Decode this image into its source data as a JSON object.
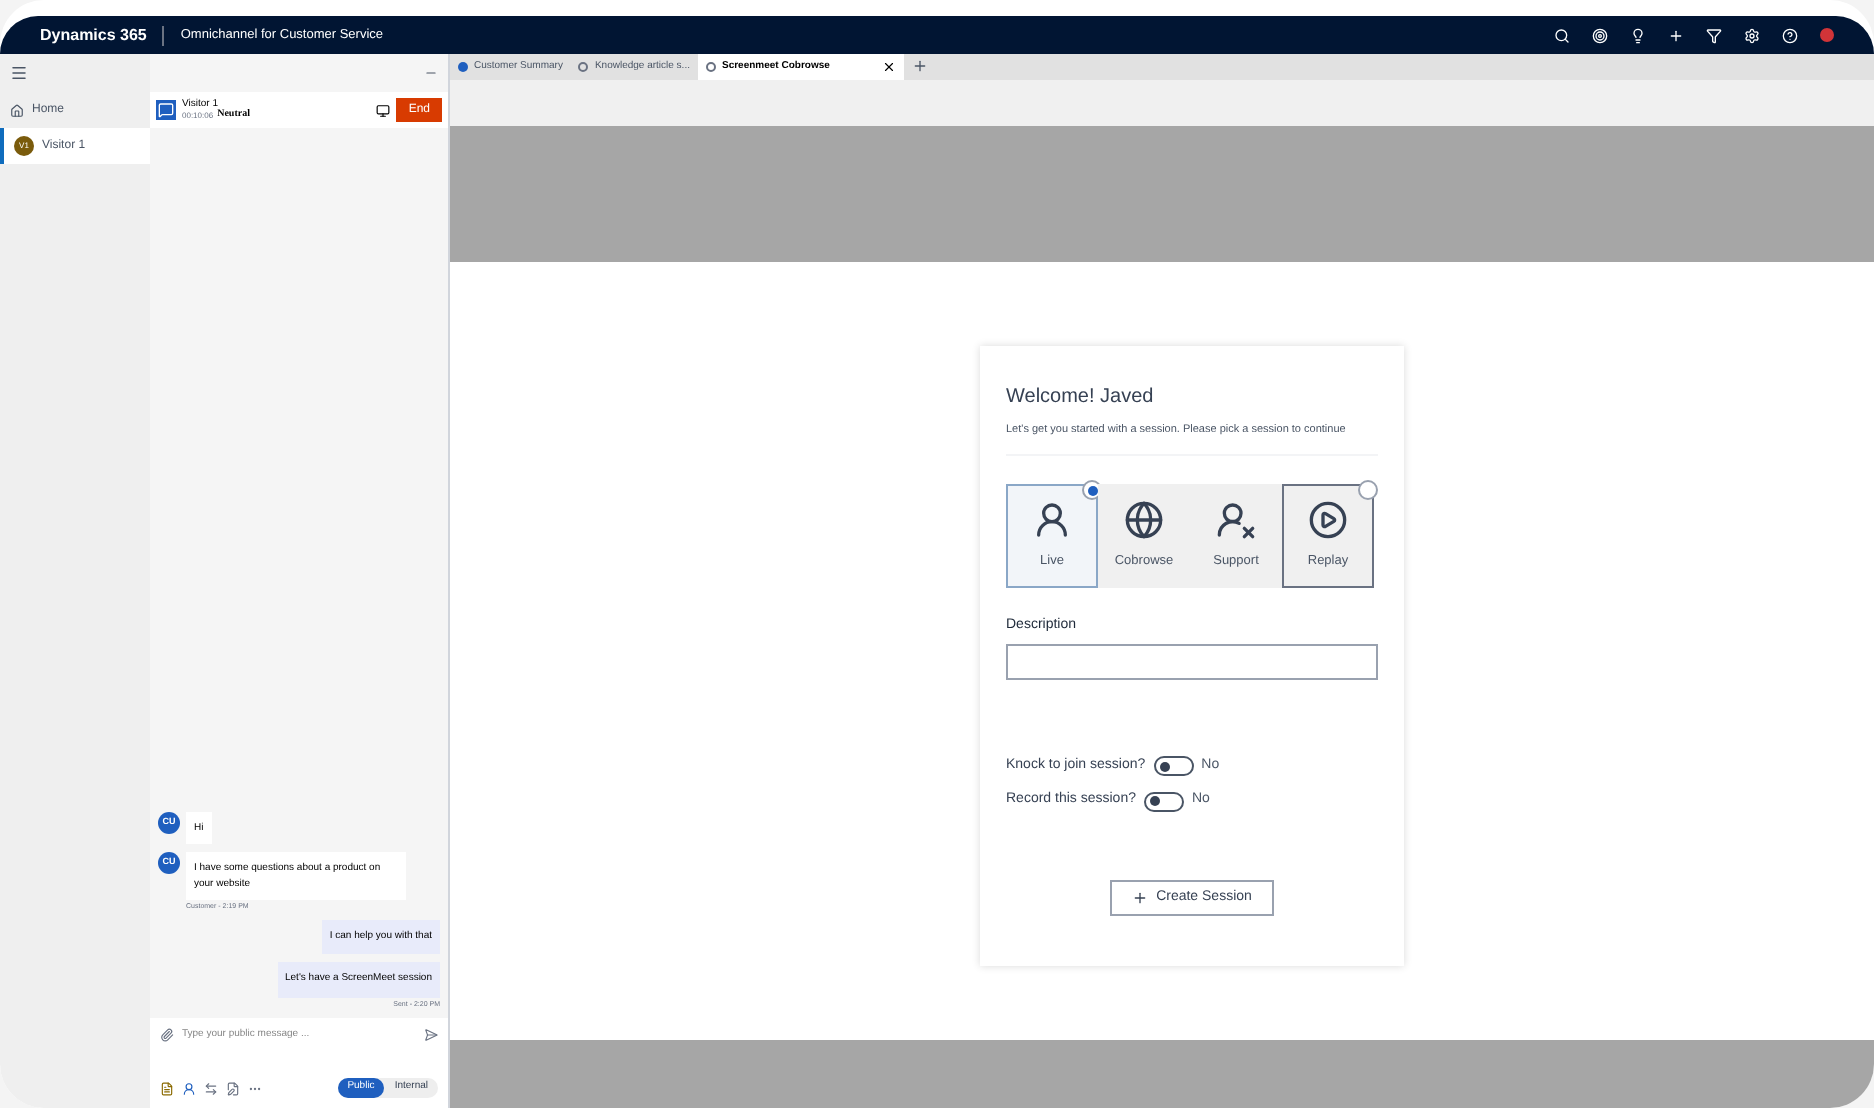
{
  "app": {
    "brand": "Dynamics 365",
    "title": "Omnichannel for Customer Service"
  },
  "nav": [
    {
      "label": "Home",
      "kind": "home",
      "selected": false
    },
    {
      "label": "Visitor 1",
      "kind": "session",
      "initials": "V1",
      "selected": true
    }
  ],
  "conversation": {
    "name": "Visitor 1",
    "timer": "00:10:06",
    "sentiment": "Neutral",
    "end_label": "End"
  },
  "tabs": [
    {
      "label": "Customer Summary",
      "selected": false
    },
    {
      "label": "Knowledge article s...",
      "selected": false
    },
    {
      "label": "Screenmeet Cobrowse",
      "selected": true
    }
  ],
  "messages": [
    {
      "kind": "customer",
      "avatar": "CU",
      "text": "Hi"
    },
    {
      "kind": "customer",
      "avatar": "CU",
      "text": "I have some questions about a product on your website",
      "meta": "Customer - 2:19 PM"
    },
    {
      "kind": "agent",
      "text": "I can help you with that"
    },
    {
      "kind": "agent",
      "text": "Let's have a ScreenMeet session",
      "meta": "Sent - 2:20 PM"
    }
  ],
  "composer": {
    "placeholder": "Type your public message ...",
    "modes": [
      {
        "label": "Public",
        "selected": true
      },
      {
        "label": "Internal",
        "selected": false
      }
    ]
  },
  "session_card": {
    "title": "Welcome! Javed",
    "subtitle": "Let's get you started with a session. Please pick a session to continue",
    "options": [
      {
        "label": "Live",
        "kind": "live",
        "selected": true
      },
      {
        "label": "Cobrowse",
        "kind": "cobrowse",
        "selected": false
      },
      {
        "label": "Support",
        "kind": "support",
        "selected": false
      },
      {
        "label": "Replay",
        "kind": "replay",
        "selected": false
      }
    ],
    "description_label": "Description",
    "toggles": [
      {
        "label": "Knock to join session?",
        "on": false,
        "state_text": "No"
      },
      {
        "label": "Record this session?",
        "on": false,
        "state_text": "No"
      }
    ],
    "create_label": "Create Session"
  }
}
